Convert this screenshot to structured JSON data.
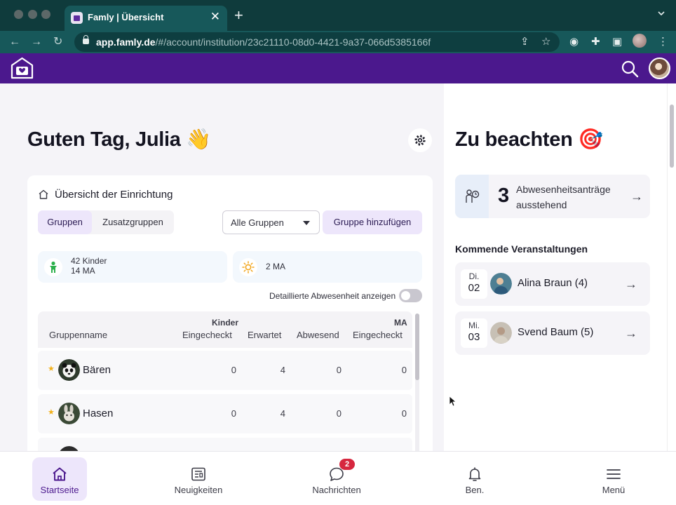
{
  "browser": {
    "tab_title": "Famly | Übersicht",
    "tab_close": "✕",
    "new_tab": "+",
    "url_host": "app.famly.de",
    "url_path": "/#/account/institution/23c21110-08d0-4421-9a37-066d5385166f",
    "icons": [
      "back-arrow-icon",
      "forward-arrow-icon",
      "reload-icon",
      "lock-icon",
      "share-icon",
      "bookmark-star-icon",
      "extension-icon",
      "puzzle-icon",
      "sidebar-icon",
      "profile-avatar",
      "kebab-menu-icon"
    ]
  },
  "app": {
    "brand_color": "#4b188d",
    "accent_light": "#ede6fb"
  },
  "main": {
    "greeting": "Guten Tag, Julia 👋",
    "overview_card": {
      "title": "Übersicht der Einrichtung",
      "segments": [
        {
          "label": "Gruppen",
          "active": true
        },
        {
          "label": "Zusatzgruppen",
          "active": false
        }
      ],
      "group_select_value": "Alle Gruppen",
      "add_group_label": "Gruppe hinzufügen",
      "stats": {
        "children_line": "42 Kinder",
        "staff_line": "14 MA",
        "sun_line": "2 MA"
      },
      "toggle_label": "Detaillierte Abwesenheit anzeigen",
      "toggle_on": false,
      "table": {
        "headers": {
          "group_name": "Gruppenname",
          "kinder_group": "Kinder",
          "checked_in": "Eingecheckt",
          "expected": "Erwartet",
          "absent": "Abwesend",
          "ma_group": "MA",
          "ma_checked_in": "Eingecheckt"
        },
        "rows": [
          {
            "name": "Bären",
            "checked_in": "0",
            "expected": "4",
            "absent": "0",
            "ma_checked_in": "0"
          },
          {
            "name": "Hasen",
            "checked_in": "0",
            "expected": "4",
            "absent": "0",
            "ma_checked_in": "0"
          }
        ]
      }
    }
  },
  "side": {
    "title": "Zu beachten 🎯",
    "absence_requests": {
      "count": "3",
      "text": "Abwesenheitsanträge ausstehend"
    },
    "events_title": "Kommende Veranstaltungen",
    "events": [
      {
        "day": "Di.",
        "date": "02",
        "name": "Alina Braun (4)"
      },
      {
        "day": "Mi.",
        "date": "03",
        "name": "Svend Baum (5)"
      }
    ]
  },
  "bottom_nav": [
    {
      "label": "Startseite",
      "icon": "home-icon",
      "active": true
    },
    {
      "label": "Neuigkeiten",
      "icon": "newspaper-icon",
      "active": false
    },
    {
      "label": "Nachrichten",
      "icon": "chat-bubble-icon",
      "active": false,
      "badge": "2"
    },
    {
      "label": "Ben.",
      "icon": "bell-icon",
      "active": false
    },
    {
      "label": "Menü",
      "icon": "hamburger-menu-icon",
      "active": false
    }
  ]
}
